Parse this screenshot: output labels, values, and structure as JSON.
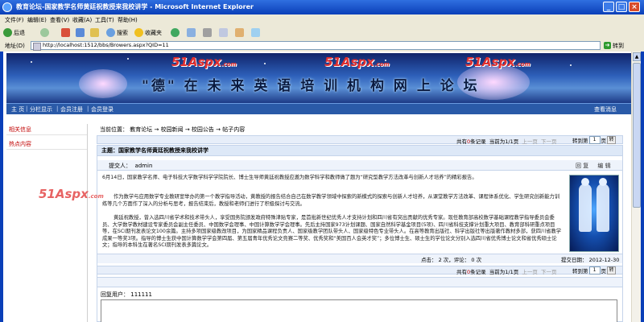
{
  "window": {
    "title": "教育论坛-国家教学名师黄廷祝教授来我校讲学 - Microsoft Internet Explorer",
    "controls": {
      "min": "_",
      "max": "□",
      "close": "×"
    }
  },
  "menu": [
    "文件(F)",
    "编辑(E)",
    "查看(V)",
    "收藏(A)",
    "工具(T)",
    "帮助(H)"
  ],
  "toolbar": {
    "back": "后退",
    "search": "搜索",
    "favorites": "收藏夹"
  },
  "address": {
    "label": "地址(D)",
    "url": "http://localhost:1512/bbs/Browers.aspx?QID=11",
    "go": "转到"
  },
  "banner": {
    "watermark": "51Aspx",
    "watermark_suffix": ".com",
    "slogan": "\"德\" 在 未 来 英 语 培 训 机 构 网 上 论 坛"
  },
  "nav": {
    "items": [
      "主 页",
      "分栏显示",
      "会员注册",
      "会员登录"
    ],
    "right": "查看消息"
  },
  "sidebar": {
    "items": [
      "相关信息",
      "热点内容"
    ]
  },
  "breadcrumb": {
    "prefix": "当前位置：",
    "items": [
      "教育论坛",
      "校园新闻",
      "校园公告",
      "帖子内容"
    ],
    "arrow": "→"
  },
  "pager": {
    "total_prefix": "共有",
    "total": "0",
    "total_suffix": "条记录",
    "page_text": "当前为1/1页",
    "prev": "上一页",
    "next": "下一页",
    "jump_label": "转到第",
    "jump_value": "1",
    "jump_suffix": "页",
    "jump_button": "转"
  },
  "topic": {
    "title": "主题：国家教学名师黄廷祝教授来我校讲学",
    "poster_label": "提交人：",
    "poster": "admin",
    "reply_action": "回 复",
    "edit_action": "编 辑",
    "paragraphs": [
      "6月14日，国家教学名师、电子科技大学数学科学学院院长、博士生导师黄廷祝教授应邀为数学科学和教师做了题为“研究型教学方法改革与创新人才培养”的精彩报告。",
      "作为数学与应用数学专业教研室举办的第一个教学指导活动，黄教授的报告结合自己在数学教学领域中探索的新模式的探索与创新人才培养，从课堂教学方法改革、课程体系优化、学生研究创新能力训练等几个方面作了深入的分析与思考，报告结束后，教授和老师们进行了积极探讨与交流。",
      "黄廷祝教授，曾入选四川省学术和技术带头人，享受国务院颁发政府特殊津贴专家，是首批新世纪优秀人才支持计划和四川省有突出贡献的优秀专家。现任教育部高校数学基础课程教学指导委员会委员、大学数学教材建设专家委员会副主任委员、中国数学会理事、中国计算数学学会理事。先后主持国家973计划课题、国家自然科学基金项目(5项)、四川省科技支撑计划重大项目、教育部科研重点项目等，在SCI期刊发表论文100余篇。主持多项国家级教改项目，为国家精品课程负责人、国家级教学团队带头人、国家级特色专业带头人。在高等教育出版社、科学出版社等出版著作教材多部，获四川省教学成果一等奖3项。指导的博士生获中国计算数学学会第四届、第五届青年优秀论文竞赛二等奖、优秀奖和“美国百人会英才奖”；多位博士生、硕士生的学位论文分别入选四川省优秀博士论文和省优秀硕士论文；指导的本科生在著名SCI期刊发表多篇论文。"
    ],
    "footer": {
      "clicks_label": "点击：",
      "clicks": "2",
      "clicks_unit": "次",
      "comments_label": "评论：",
      "comments": "0",
      "comments_unit": "次",
      "date_label": "提交日期：",
      "date": "2012-12-30"
    }
  },
  "reply": {
    "user_label": "回复用户：",
    "user": "111111"
  },
  "colors": {
    "titlebar": "#0a3fb8",
    "nav": "#2a5aa8",
    "accent_red": "#c00000",
    "pager_bg": "#e7eef9"
  }
}
